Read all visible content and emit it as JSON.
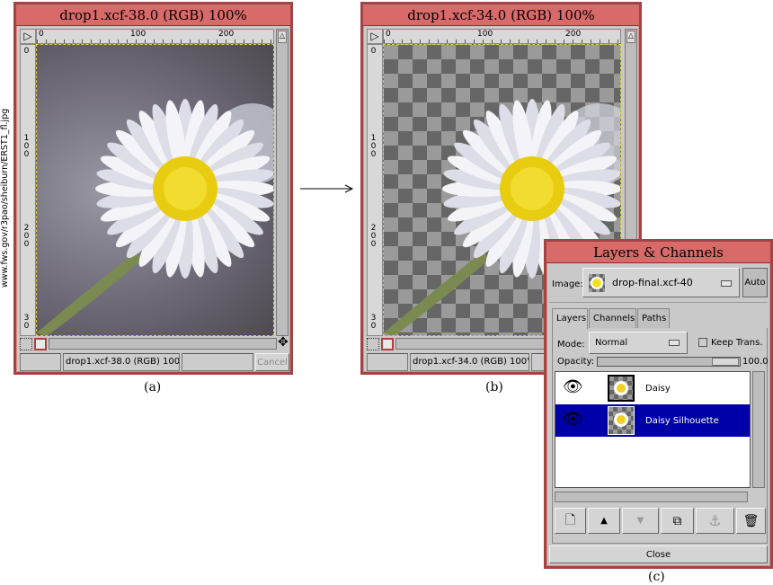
{
  "source_text": "www.fws.gov/r3pao/sheiburn/ERST1_fl.jpg",
  "window_a": {
    "title": "drop1.xcf-38.0 (RGB) 100%",
    "ruler_h": [
      "0",
      "100",
      "200"
    ],
    "ruler_v": [
      "0",
      "1 0 0",
      "2 0 0",
      "3 0"
    ],
    "status": "drop1.xcf-38.0 (RGB) 100",
    "cancel": "Cancel",
    "caption": "(a)"
  },
  "window_b": {
    "title": "drop1.xcf-34.0 (RGB) 100%",
    "ruler_h": [
      "0",
      "100",
      "200"
    ],
    "ruler_v": [
      "0",
      "1 0 0",
      "2 0 0",
      "3 0"
    ],
    "status": "drop1.xcf-34.0 (RGB) 100'",
    "caption": "(b)"
  },
  "layers": {
    "title": "Layers & Channels",
    "image_label": "Image:",
    "image_value": "drop-final.xcf-40",
    "auto": "Auto",
    "tabs": [
      {
        "label": "Layers",
        "active": true
      },
      {
        "label": "Channels"
      },
      {
        "label": "Paths"
      }
    ],
    "mode_label": "Mode:",
    "mode_value": "Normal",
    "keep_trans": "Keep Trans.",
    "keep_trans_checked": false,
    "opacity_label": "Opacity:",
    "opacity_value": "100.0",
    "items": [
      {
        "name": "Daisy",
        "visible": true,
        "selected": false
      },
      {
        "name": "Daisy Silhouette",
        "visible": true,
        "selected": true
      }
    ],
    "buttons": [
      "new-layer-icon",
      "raise-layer-icon",
      "lower-layer-icon",
      "duplicate-layer-icon",
      "anchor-icon",
      "trash-icon"
    ],
    "close": "Close",
    "caption": "(c)",
    "selection_color": "#0000a8"
  }
}
